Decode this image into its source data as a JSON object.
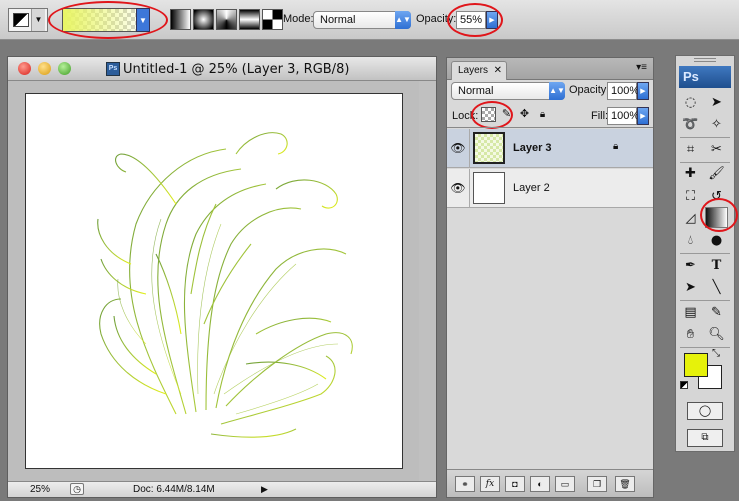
{
  "options_bar": {
    "mode_label": "Mode:",
    "mode_value": "Normal",
    "opacity_label": "Opacity:",
    "opacity_value": "55%"
  },
  "document": {
    "title": "Untitled-1 @ 25% (Layer 3, RGB/8)",
    "ps_badge": "Ps",
    "zoom": "25%",
    "doc_info": "Doc: 6.44M/8.14M"
  },
  "layers_panel": {
    "tab_label": "Layers",
    "blend_mode": "Normal",
    "opacity_label": "Opacity:",
    "opacity_value": "100%",
    "lock_label": "Lock:",
    "fill_label": "Fill:",
    "fill_value": "100%",
    "layers": [
      {
        "name": "Layer 3",
        "selected": true
      },
      {
        "name": "Layer 2",
        "selected": false
      }
    ]
  },
  "toolbox": {
    "logo": "Ps",
    "foreground_color": "#e6f20a",
    "background_color": "#ffffff"
  },
  "annotation_color": "#e0161b"
}
